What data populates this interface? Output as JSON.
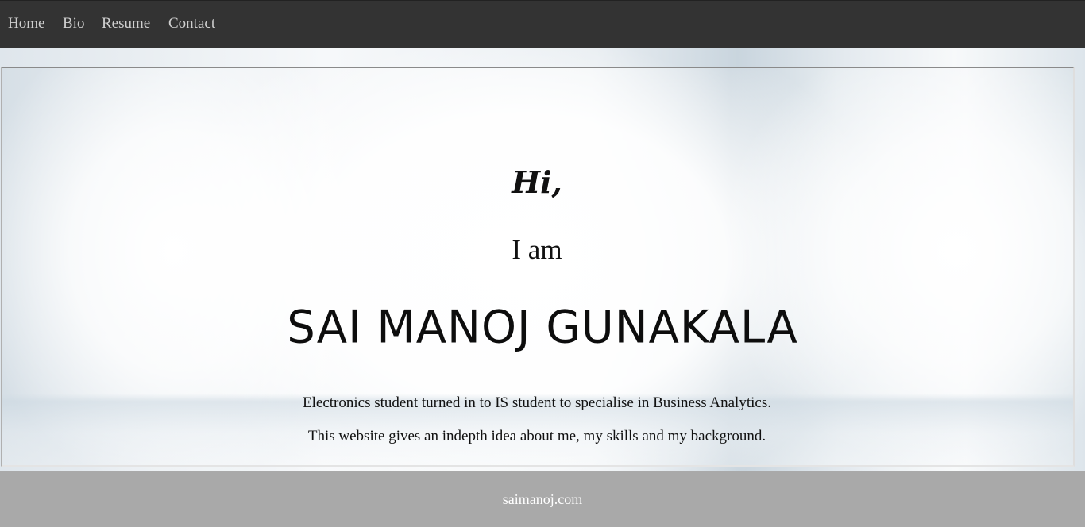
{
  "nav": {
    "items": [
      {
        "label": "Home"
      },
      {
        "label": "Bio"
      },
      {
        "label": "Resume"
      },
      {
        "label": "Contact"
      }
    ]
  },
  "hero": {
    "greeting": "Hi,",
    "intro": "I am",
    "name": "SAI MANOJ GUNAKALA",
    "description_lines": [
      "Electronics student turned in to IS student to specialise in Business Analytics.",
      "This website gives an indepth idea about me, my skills and my background."
    ]
  },
  "footer": {
    "text": "saimanoj.com"
  },
  "colors": {
    "navbar_bg": "#333333",
    "nav_text": "#cfcfcf",
    "footer_bg": "#a9a9a9",
    "footer_text": "#ffffff"
  }
}
